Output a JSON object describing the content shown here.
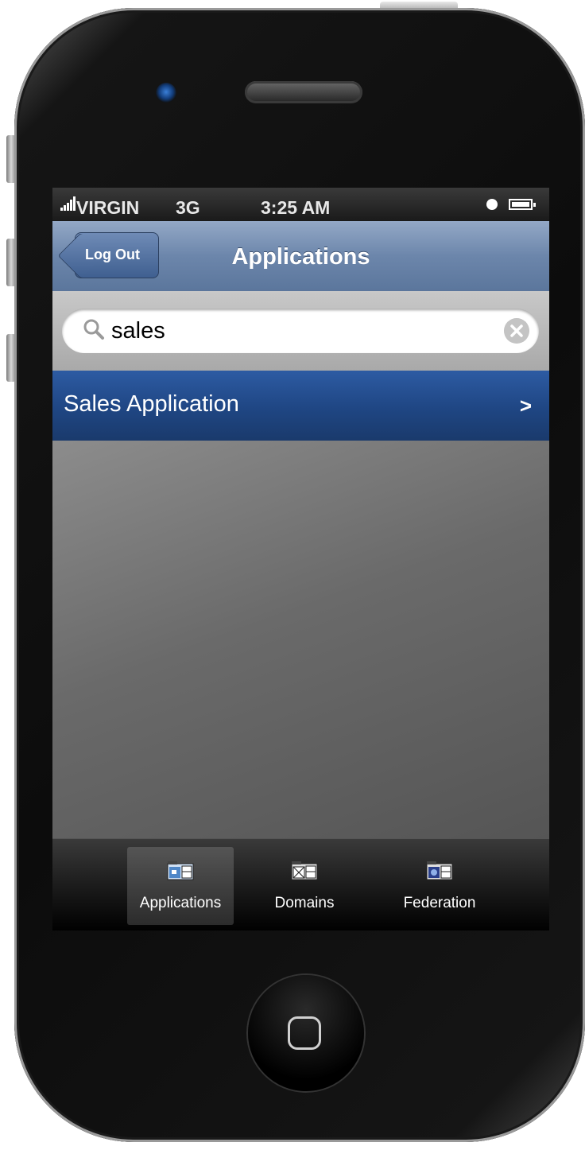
{
  "status_bar": {
    "carrier": "VIRGIN",
    "network": "3G",
    "time": "3:25 AM"
  },
  "nav": {
    "back_label": "Log Out",
    "title": "Applications"
  },
  "search": {
    "value": "sales"
  },
  "results": [
    {
      "label": "Sales Application",
      "chevron": ">"
    }
  ],
  "tabs": [
    {
      "label": "Applications",
      "icon": "applications-icon",
      "active": true
    },
    {
      "label": "Domains",
      "icon": "domains-icon",
      "active": false
    },
    {
      "label": "Federation",
      "icon": "federation-icon",
      "active": false
    }
  ],
  "colors": {
    "nav_bar": "#6c86ab",
    "selected_row": "#1f4683",
    "tab_bar": "#1c1c1c"
  }
}
